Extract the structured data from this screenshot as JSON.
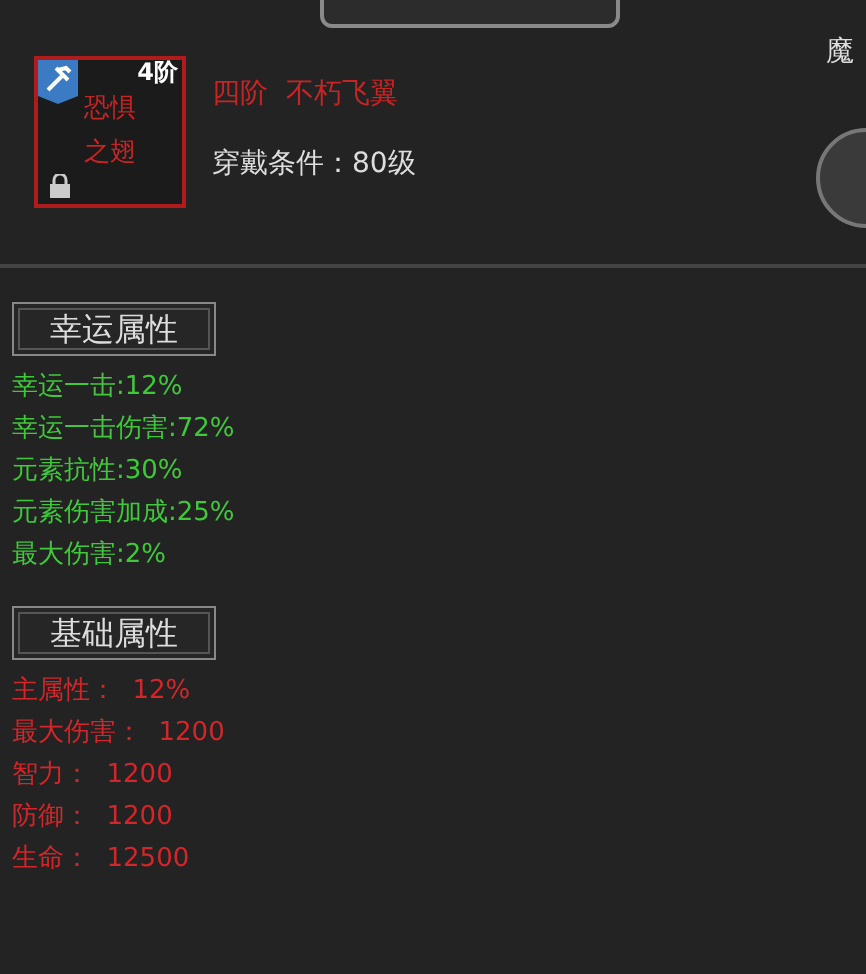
{
  "item": {
    "grade_badge": "4阶",
    "name_lines": [
      "恐惧",
      "之翅"
    ],
    "locked": true,
    "title": "四阶  不朽飞翼",
    "requirement": "穿戴条件：80级"
  },
  "side": {
    "label": "魔"
  },
  "sections": [
    {
      "title": "幸运属性",
      "kind": "luck",
      "lines": [
        "幸运一击:12%",
        "幸运一击伤害:72%",
        "元素抗性:30%",
        "元素伤害加成:25%",
        "最大伤害:2%"
      ]
    },
    {
      "title": "基础属性",
      "kind": "base",
      "lines": [
        "主属性：  12%",
        "最大伤害：  1200",
        "智力：  1200",
        "防御：  1200",
        "生命：  12500"
      ]
    }
  ]
}
